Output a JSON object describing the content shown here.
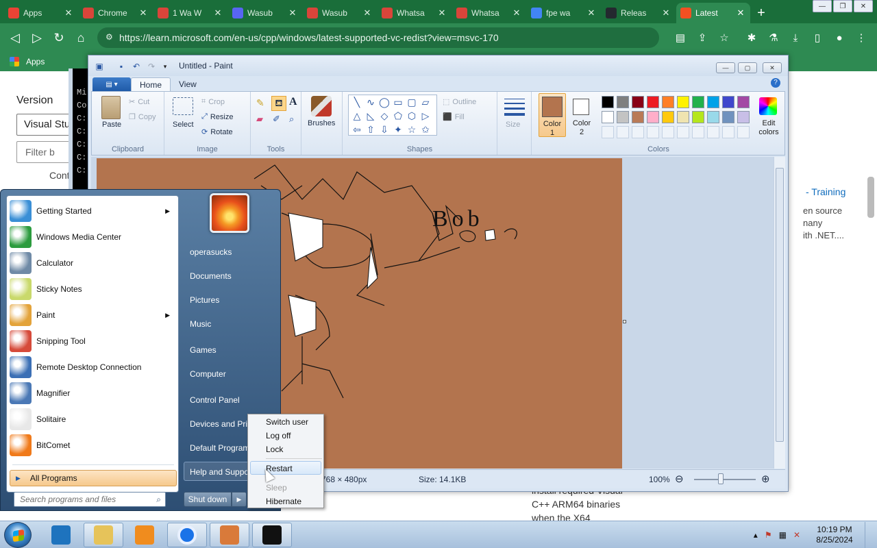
{
  "browser": {
    "tabs": [
      {
        "title": "Apps",
        "favicon_color": "#ea4335"
      },
      {
        "title": "Chrome",
        "favicon_color": "#d9453a"
      },
      {
        "title": "1 Wa W",
        "favicon_color": "#d9453a"
      },
      {
        "title": "Wasub",
        "favicon_color": "#5865f2"
      },
      {
        "title": "Wasub",
        "favicon_color": "#d9453a"
      },
      {
        "title": "Whatsa",
        "favicon_color": "#d9453a"
      },
      {
        "title": "Whatsa",
        "favicon_color": "#d9453a"
      },
      {
        "title": "fpe wa",
        "favicon_color": "#4285f4"
      },
      {
        "title": "Releas",
        "favicon_color": "#24292f"
      },
      {
        "title": "Latest",
        "favicon_color": "#f25022",
        "active": true
      }
    ],
    "url": "https://learn.microsoft.com/en-us/cpp/windows/latest-supported-vc-redist?view=msvc-170",
    "bookmarks": [
      {
        "label": "Apps"
      }
    ],
    "theme_color": "#2e8a52"
  },
  "webpage": {
    "version_heading": "Version",
    "dropdown_value": "Visual Stu",
    "filter_placeholder": "Filter b",
    "contents_label": "Cont",
    "training_link": "- Training",
    "right_text_1": "en source",
    "right_text_2": "nany",
    "right_text_3": "ith .NET....",
    "bottom_text_1": "install required Visual",
    "bottom_text_2": "C++ ARM64 binaries",
    "bottom_text_3": "when the X64"
  },
  "cmd": {
    "lines": [
      "Mi",
      "Co",
      "C:",
      "C:",
      "C:",
      "C:",
      "C:"
    ]
  },
  "paint": {
    "title": "Untitled - Paint",
    "tabs": [
      {
        "label": "Home",
        "active": true
      },
      {
        "label": "View"
      }
    ],
    "clipboard": {
      "label": "Clipboard",
      "paste": "Paste",
      "cut": "Cut",
      "copy": "Copy"
    },
    "image": {
      "label": "Image",
      "select": "Select",
      "crop": "Crop",
      "resize": "Resize",
      "rotate": "Rotate"
    },
    "tools": {
      "label": "Tools"
    },
    "brushes": {
      "label": "Brushes"
    },
    "shapes": {
      "label": "Shapes",
      "outline": "Outline",
      "fill": "Fill"
    },
    "size": {
      "label": "Size"
    },
    "colors": {
      "label": "Colors",
      "color1_label": "Color\n1",
      "color2_label": "Color\n2",
      "edit_label": "Edit\ncolors",
      "color1": "#b3744e",
      "color2": "#ffffff",
      "row1": [
        "#000000",
        "#7f7f7f",
        "#880015",
        "#ed1c24",
        "#ff7f27",
        "#fff200",
        "#22b14c",
        "#00a2e8",
        "#3f48cc",
        "#a349a4"
      ],
      "row2": [
        "#ffffff",
        "#c3c3c3",
        "#b97a57",
        "#ffaec9",
        "#ffc90e",
        "#efe4b0",
        "#b5e61d",
        "#99d9ea",
        "#7092be",
        "#c8bfe7"
      ]
    },
    "canvas_color": "#b3744e",
    "canvas_text": "Bob",
    "status": {
      "dimensions": "768 × 480px",
      "size": "Size: 14.1KB",
      "zoom": "100%"
    }
  },
  "start_menu": {
    "programs": [
      {
        "label": "Getting Started",
        "has_arrow": true,
        "icon_color": "#3a8fd6"
      },
      {
        "label": "Windows Media Center",
        "has_arrow": false,
        "icon_color": "#2c9b3e"
      },
      {
        "label": "Calculator",
        "has_arrow": false,
        "icon_color": "#6f8aa6"
      },
      {
        "label": "Sticky Notes",
        "has_arrow": false,
        "icon_color": "#c9d96b"
      },
      {
        "label": "Paint",
        "has_arrow": true,
        "icon_color": "#e3a33a"
      },
      {
        "label": "Snipping Tool",
        "has_arrow": false,
        "icon_color": "#d64a3a"
      },
      {
        "label": "Remote Desktop Connection",
        "has_arrow": false,
        "icon_color": "#3b6fb5"
      },
      {
        "label": "Magnifier",
        "has_arrow": false,
        "icon_color": "#4a78b5"
      },
      {
        "label": "Solitaire",
        "has_arrow": false,
        "icon_color": "#e8e8e8"
      },
      {
        "label": "BitComet",
        "has_arrow": false,
        "icon_color": "#f07a1a"
      }
    ],
    "all_programs": "All Programs",
    "search_placeholder": "Search programs and files",
    "right_items": [
      {
        "label": "operasucks"
      },
      {
        "label": "Documents"
      },
      {
        "label": "Pictures"
      },
      {
        "label": "Music"
      },
      {
        "label": "Games"
      },
      {
        "label": "Computer"
      },
      {
        "label": "Control Panel"
      },
      {
        "label": "Devices and Prin"
      },
      {
        "label": "Default Program"
      },
      {
        "label": "Help and Suppo"
      }
    ],
    "shutdown_label": "Shut down",
    "power_menu": [
      {
        "label": "Switch user",
        "disabled": false
      },
      {
        "label": "Log off",
        "disabled": false
      },
      {
        "label": "Lock",
        "disabled": false
      },
      {
        "label": "Restart",
        "disabled": false,
        "highlighted": true
      },
      {
        "label": "Sleep",
        "disabled": true
      },
      {
        "label": "Hibernate",
        "disabled": false
      }
    ]
  },
  "taskbar": {
    "items": [
      {
        "name": "internet-explorer",
        "color": "#1e73be"
      },
      {
        "name": "file-explorer",
        "color": "#e6c35a"
      },
      {
        "name": "media-player",
        "color": "#f08c1e"
      },
      {
        "name": "chrome",
        "color": "#1a73e8"
      },
      {
        "name": "paint",
        "color": "#d97a3a"
      },
      {
        "name": "cmd",
        "color": "#111111"
      }
    ],
    "time": "10:19 PM",
    "date": "8/25/2024"
  }
}
